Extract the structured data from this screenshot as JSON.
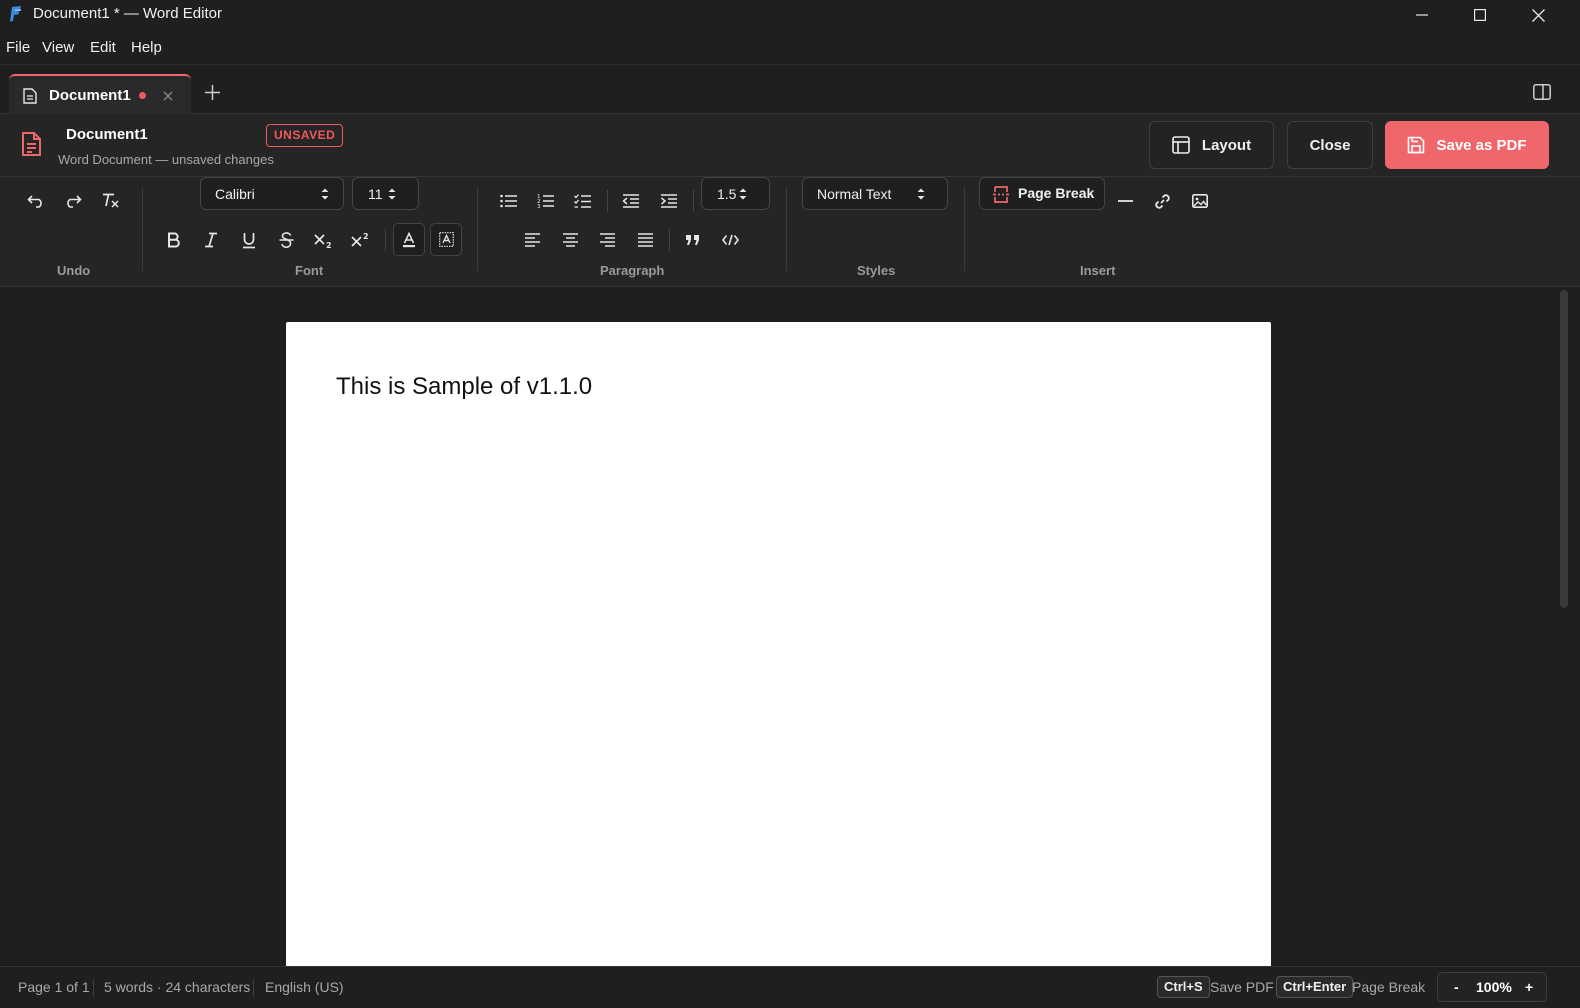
{
  "window": {
    "title": "Document1 * — Word Editor"
  },
  "menu": {
    "items": [
      "File",
      "View",
      "Edit",
      "Help"
    ]
  },
  "tabs": [
    {
      "label": "Document1",
      "modified": true
    }
  ],
  "header": {
    "title": "Document1",
    "badge": "UNSAVED",
    "subtitle": "Word Document — unsaved changes",
    "layout_label": "Layout",
    "close_label": "Close",
    "save_pdf_label": "Save as PDF"
  },
  "ribbon": {
    "groups": {
      "undo": "Undo",
      "font": "Font",
      "paragraph": "Paragraph",
      "styles": "Styles",
      "insert": "Insert"
    },
    "font_family": "Calibri",
    "font_size": "11",
    "line_spacing": "1.5",
    "style": "Normal Text",
    "page_break_label": "Page Break"
  },
  "document": {
    "text": "This is Sample of v1.1.0"
  },
  "status": {
    "page": "Page 1 of 1",
    "counts": "5 words · 24 characters",
    "language": "English (US)",
    "shortcut1_key": "Ctrl+S",
    "shortcut1_label": "Save PDF ·",
    "shortcut2_key": "Ctrl+Enter",
    "shortcut2_label": "Page Break",
    "zoom": "100%",
    "zoom_out": "-",
    "zoom_in": "+"
  },
  "colors": {
    "accent": "#f0676b",
    "unsaved": "#f05a5e",
    "background": "#1e1e1e",
    "page": "#ffffff"
  }
}
